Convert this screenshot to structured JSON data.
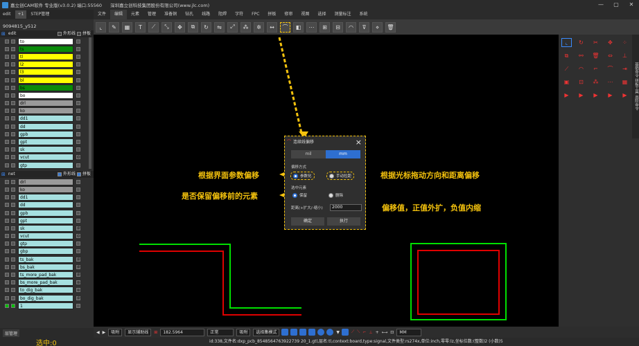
{
  "window": {
    "title": "嘉立创CAM软件 专业版(v3.0.2) 端口:55560",
    "company": "深圳嘉立创科技集团股份有限公司(www.jlc.com)",
    "controls": [
      "—",
      "▢",
      "✕"
    ]
  },
  "menu": [
    "文件",
    "编辑",
    "元素",
    "管理",
    "准备铜",
    "钻孔",
    "线路",
    "阻焊",
    "字符",
    "FPC",
    "拼板",
    "修审",
    "视图",
    "选择",
    "测量标注",
    "系统"
  ],
  "menu_active": "编辑",
  "left": {
    "tabs": [
      "edit",
      "+1",
      "STEP管理"
    ],
    "job": "9094815_y512",
    "group1": {
      "name": "edit",
      "opt1": "外形线",
      "opt2": "拼板"
    },
    "group2": {
      "name": "net",
      "opt1": "外形线",
      "opt2": "拼板"
    },
    "layers1": [
      {
        "name": "to",
        "color": "#ffffff"
      },
      {
        "name": "ts",
        "color": "#0a8a0a"
      },
      {
        "name": "tl",
        "color": "#ffff00"
      },
      {
        "name": "l2",
        "color": "#ffff00"
      },
      {
        "name": "l3",
        "color": "#ffff00"
      },
      {
        "name": "bl",
        "color": "#ffff00"
      },
      {
        "name": "bs",
        "color": "#0a8a0a"
      },
      {
        "name": "bo",
        "color": "#ffffff"
      },
      {
        "name": "drl",
        "color": "#9a9a9a"
      },
      {
        "name": "ko",
        "color": "#9a9a9a"
      },
      {
        "name": "dd1",
        "color": "#a6e0e0"
      },
      {
        "name": "dd",
        "color": "#a6e0e0"
      },
      {
        "name": "gpb",
        "color": "#a6e0e0"
      },
      {
        "name": "gpt",
        "color": "#a6e0e0"
      },
      {
        "name": "sk",
        "color": "#a6e0e0"
      },
      {
        "name": "vcut",
        "color": "#a6e0e0",
        "mark": "O"
      },
      {
        "name": "gtp",
        "color": "#a6e0e0"
      }
    ],
    "layers2": [
      {
        "name": "drl",
        "color": "#9a9a9a"
      },
      {
        "name": "ko",
        "color": "#9a9a9a"
      },
      {
        "name": "dd1",
        "color": "#a6e0e0"
      },
      {
        "name": "dd",
        "color": "#a6e0e0"
      },
      {
        "name": "gpb",
        "color": "#a6e0e0"
      },
      {
        "name": "gpt",
        "color": "#a6e0e0"
      },
      {
        "name": "sk",
        "color": "#a6e0e0",
        "mark": "⊕"
      },
      {
        "name": "vcut",
        "color": "#a6e0e0",
        "mark": "O"
      },
      {
        "name": "gtp",
        "color": "#a6e0e0"
      },
      {
        "name": "gbp",
        "color": "#a6e0e0"
      },
      {
        "name": "ts_bak",
        "color": "#a6e0e0",
        "mark": "⊕"
      },
      {
        "name": "bs_bak",
        "color": "#a6e0e0",
        "mark": "⊕"
      },
      {
        "name": "ts_more_pad_bak",
        "color": "#a6e0e0",
        "mark": "⊕"
      },
      {
        "name": "bs_more_pad_bak",
        "color": "#a6e0e0",
        "mark": "⊕"
      },
      {
        "name": "to_dig_bak",
        "color": "#a6e0e0",
        "mark": "⊕"
      },
      {
        "name": "bo_dig_bak",
        "color": "#a6e0e0",
        "mark": "⊕"
      },
      {
        "name": "1",
        "color": "#a6e0e0",
        "swatch": "#00c000"
      }
    ],
    "bottom_button": "层管理",
    "selected": "选中:0"
  },
  "dialog": {
    "title": "连续线偏移",
    "tabs": [
      "mil",
      "mm"
    ],
    "active_tab": "mm",
    "section1": "偏移方式",
    "opt_params": "参数化",
    "opt_manual": "手动拉距",
    "section2": "选中元素",
    "opt_keep": "保留",
    "opt_delete": "删除",
    "dist_label": "距离(+扩大/-缩小)",
    "dist_value": "2000",
    "ok": "确定",
    "apply": "执行"
  },
  "annotations": {
    "a1": "根据界面参数偏移",
    "a2": "根据光标拖动方向和距离偏移",
    "a3": "是否保留偏移前的元素",
    "a4": "偏移值，正值外扩，负值内缩"
  },
  "bottom": {
    "mode": "吸附",
    "display": "显示辅助线",
    "coord": "182.5964",
    "snap": "正常",
    "cap": "吸附",
    "sel": "选择集模式",
    "unit": "MM"
  },
  "status": "id:338,文件名:dxp_pcb_8548564763922739 20_1.gtl,层名:tl,context:board,type:signal,文件类型:rs274x,单位:inch,零零:lz,坐标位数:(整数)2 (小数)5",
  "right_tabs": "基础命令 拼板工具 高阶命令",
  "icons": [
    "select-tool-icon",
    "pen-icon",
    "magnet-icon",
    "delete-icon",
    "arrow-icon"
  ]
}
